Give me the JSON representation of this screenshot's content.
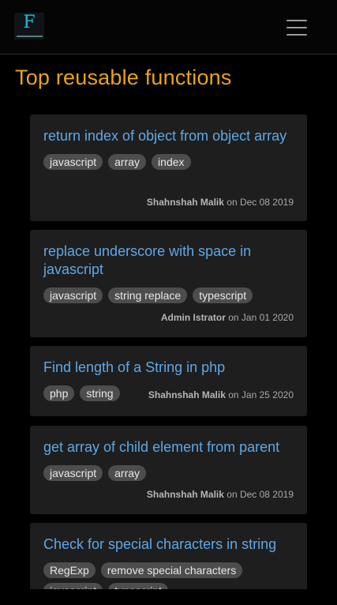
{
  "navbar": {
    "logo_letter": "F",
    "menu_icon": "hamburger-menu-icon"
  },
  "page": {
    "title": "Top reusable functions"
  },
  "posts": [
    {
      "title": "return index of object from object array",
      "tags": [
        "javascript",
        "array",
        "index"
      ],
      "author": "Shahnshah Malik",
      "date_text": "on Dec 08 2019"
    },
    {
      "title": "replace underscore with space in javascript",
      "tags": [
        "javascript",
        "string replace",
        "typescript"
      ],
      "author": "Admin Istrator",
      "date_text": "on Jan 01 2020"
    },
    {
      "title": "Find length of a String in php",
      "tags": [
        "php",
        "string"
      ],
      "author": "Shahnshah Malik",
      "date_text": "on Jan 25 2020"
    },
    {
      "title": "get array of child element from parent",
      "tags": [
        "javascript",
        "array"
      ],
      "author": "Shahnshah Malik",
      "date_text": "on Dec 08 2019"
    },
    {
      "title": "Check for special characters in string",
      "tags": [
        "RegExp",
        "remove special characters",
        "javascript",
        "typescript"
      ],
      "author": "",
      "date_text": ""
    }
  ]
}
